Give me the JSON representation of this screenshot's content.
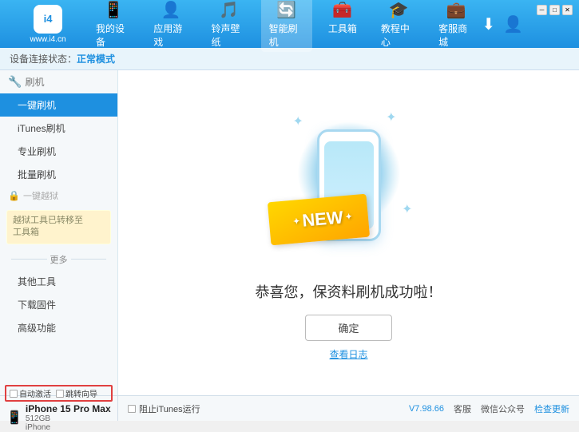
{
  "app": {
    "logo_circle": "i4",
    "logo_url": "www.i4.cn",
    "win_controls": [
      "─",
      "□",
      "✕"
    ]
  },
  "nav": {
    "items": [
      {
        "id": "my-device",
        "icon": "📱",
        "label": "我的设备"
      },
      {
        "id": "apps-games",
        "icon": "👤",
        "label": "应用游戏"
      },
      {
        "id": "ringtones",
        "icon": "🎵",
        "label": "铃声壁纸"
      },
      {
        "id": "smart-flash",
        "icon": "🔄",
        "label": "智能刷机",
        "active": true
      },
      {
        "id": "toolbox",
        "icon": "🧰",
        "label": "工具箱"
      },
      {
        "id": "tutorial",
        "icon": "🎓",
        "label": "教程中心"
      },
      {
        "id": "service",
        "icon": "💼",
        "label": "客服商城"
      }
    ]
  },
  "sub_header": {
    "prefix": "设备连接状态：",
    "mode": "正常模式"
  },
  "sidebar": {
    "section1_label": "刷机",
    "section1_icon": "🔧",
    "items": [
      {
        "id": "one-key-flash",
        "label": "一键刷机",
        "active": true
      },
      {
        "id": "itunes-flash",
        "label": "iTunes刷机",
        "active": false
      },
      {
        "id": "pro-flash",
        "label": "专业刷机",
        "active": false
      },
      {
        "id": "batch-flash",
        "label": "批量刷机",
        "active": false
      }
    ],
    "disabled_label": "一键越狱",
    "notice": "越狱工具已转移至\n工具箱",
    "section2_label": "更多",
    "section2_items": [
      {
        "id": "other-tools",
        "label": "其他工具"
      },
      {
        "id": "download-firmware",
        "label": "下载固件"
      },
      {
        "id": "advanced",
        "label": "高级功能"
      }
    ]
  },
  "content": {
    "new_badge": "NEW",
    "sparkle_left": "✦",
    "sparkle_right": "✦",
    "success_text": "恭喜您，保资料刷机成功啦！",
    "confirm_button": "确定",
    "log_link": "查看日志"
  },
  "bottom": {
    "auto_activate_label": "自动激活",
    "guide_label": "跳转向导",
    "device_name": "iPhone 15 Pro Max",
    "device_capacity": "512GB",
    "device_type": "iPhone",
    "itunes_checkbox_label": "阻止iTunes运行",
    "version": "V7.98.66",
    "status_items": [
      "客服",
      "微信公众号",
      "检查更新"
    ]
  }
}
